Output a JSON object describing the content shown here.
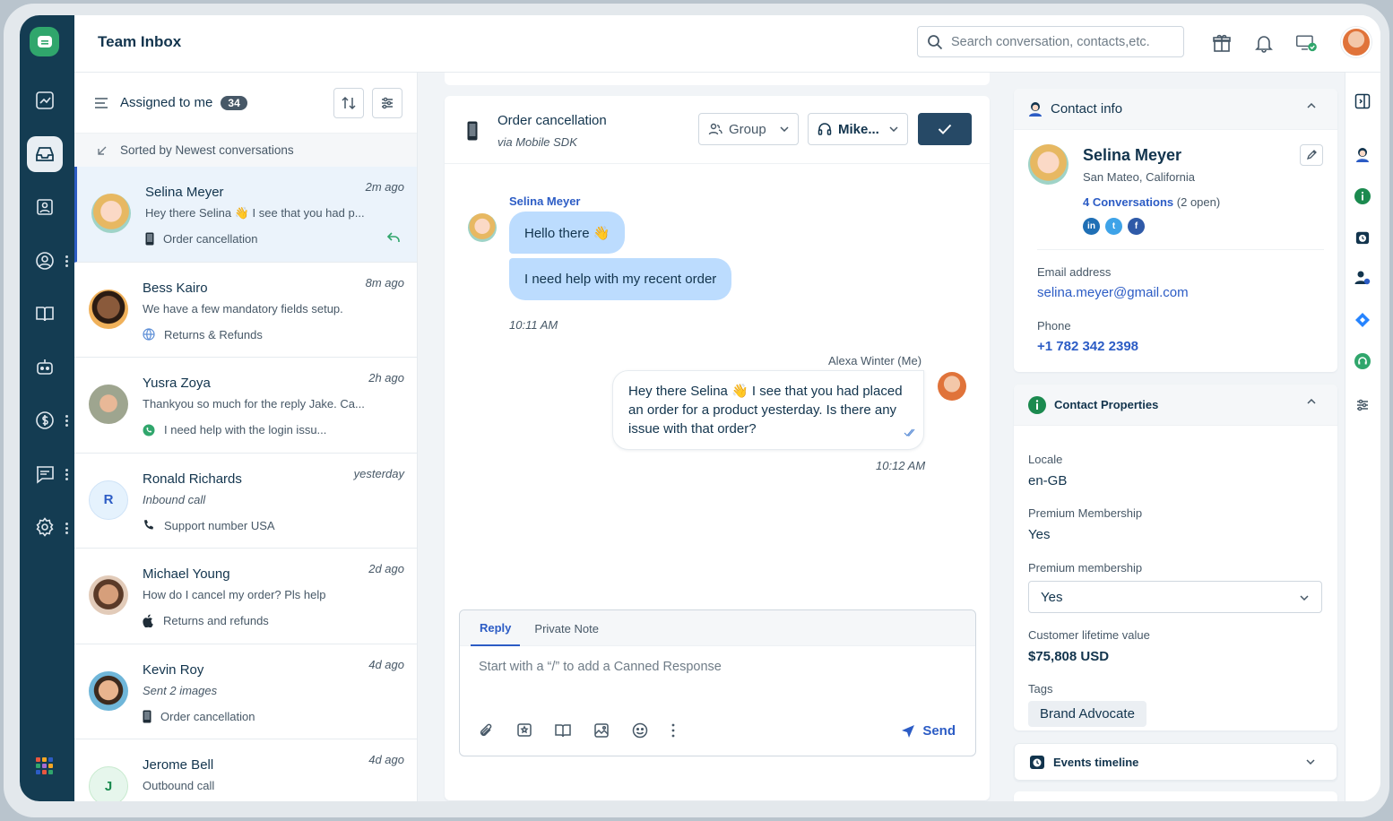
{
  "header": {
    "title": "Team Inbox",
    "search_placeholder": "Search conversation, contacts,etc."
  },
  "list": {
    "filter_label": "Assigned to me",
    "count": "34",
    "sorted_label": "Sorted by Newest conversations",
    "conversations": [
      {
        "name": "Selina Meyer",
        "time": "2m ago",
        "preview": "Hey there Selina 👋 I see that you had p...",
        "source": "Order cancellation",
        "source_icon": "mobile-icon"
      },
      {
        "name": "Bess Kairo",
        "time": "8m ago",
        "preview": "We have a few mandatory fields setup.",
        "source": "Returns & Refunds",
        "source_icon": "globe-icon"
      },
      {
        "name": "Yusra Zoya",
        "time": "2h ago",
        "preview": "Thankyou so much for the reply Jake. Ca...",
        "source": "I need help with the login issu...",
        "source_icon": "whatsapp-icon"
      },
      {
        "name": "Ronald Richards",
        "time": "yesterday",
        "preview": "Inbound call",
        "source": "Support number USA",
        "source_icon": "phone-icon",
        "initial": "R"
      },
      {
        "name": "Michael Young",
        "time": "2d ago",
        "preview": "How do I cancel my order? Pls help",
        "source": "Returns and refunds",
        "source_icon": "apple-icon"
      },
      {
        "name": "Kevin Roy",
        "time": "4d ago",
        "preview": "Sent 2 images",
        "source": "Order cancellation",
        "source_icon": "mobile-icon"
      },
      {
        "name": "Jerome Bell",
        "time": "4d ago",
        "preview": "Outbound call",
        "source": "",
        "initial": "J"
      }
    ]
  },
  "chat": {
    "title": "Order cancellation",
    "subtitle": "via Mobile SDK",
    "group_label": "Group",
    "agent_label": "Mike...",
    "incoming_name": "Selina Meyer",
    "msg1": "Hello there 👋",
    "msg2": "I need help with my recent order",
    "time1": "10:11 AM",
    "outgoing_name": "Alexa Winter (Me)",
    "msg3": "Hey there Selina 👋 I see that you had placed an order for a product yesterday. Is there any issue with that order?",
    "time2": "10:12 AM",
    "tab_reply": "Reply",
    "tab_note": "Private Note",
    "composer_placeholder": "Start with a “/” to add a Canned Response",
    "send_label": "Send"
  },
  "contact": {
    "section_title": "Contact info",
    "name": "Selina Meyer",
    "location": "San Mateo, California",
    "conversations_link": "4 Conversations",
    "conversations_open": "(2 open)",
    "email_label": "Email address",
    "email": "selina.meyer@gmail.com",
    "phone_label": "Phone",
    "phone": "+1 782 342 2398"
  },
  "properties": {
    "section_title": "Contact Properties",
    "locale_label": "Locale",
    "locale": "en-GB",
    "premium_label": "Premium Membership",
    "premium": "Yes",
    "premium2_label": "Premium membership",
    "premium2": "Yes",
    "ltv_label": "Customer lifetime value",
    "ltv": "$75,808 USD",
    "tags_label": "Tags",
    "tag1": "Brand Advocate"
  },
  "events": {
    "section_title": "Events timeline"
  },
  "colors": {
    "nav": "#143c52",
    "accent": "#2c5cc5",
    "bubble": "#bcdcfe",
    "resolve": "#264966",
    "green": "#30a66c"
  }
}
